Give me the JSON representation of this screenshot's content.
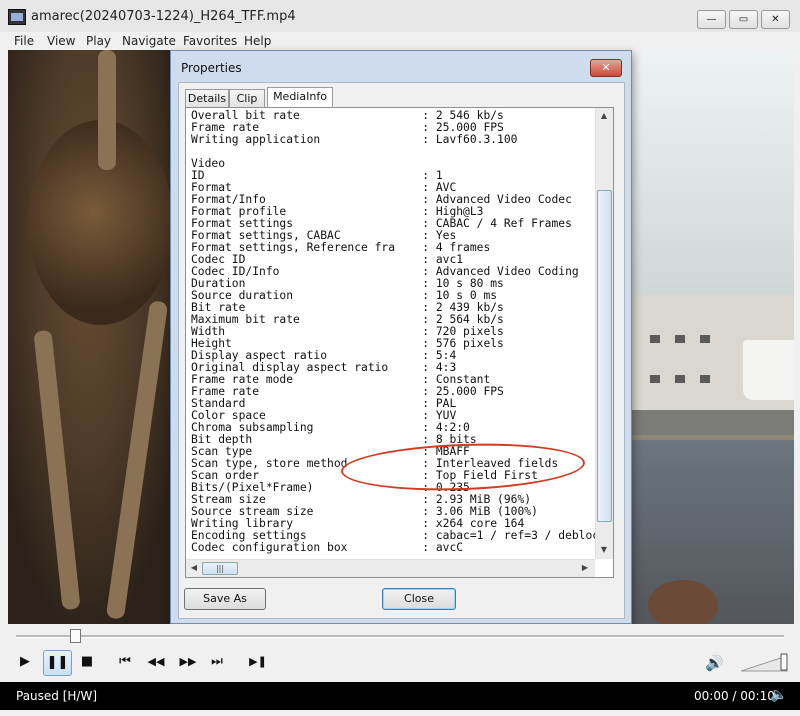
{
  "window": {
    "title": "amarec(20240703-1224)_H264_TFF.mp4",
    "minimize": "—",
    "maximize": "▭",
    "close": "✕"
  },
  "menu": [
    "File",
    "View",
    "Play",
    "Navigate",
    "Favorites",
    "Help"
  ],
  "dialog": {
    "title": "Properties",
    "close": "✕",
    "tabs": [
      "Details",
      "Clip",
      "MediaInfo"
    ],
    "active_tab": "MediaInfo",
    "info_lines": [
      "Overall bit rate                  : 2 546 kb/s",
      "Frame rate                        : 25.000 FPS",
      "Writing application               : Lavf60.3.100",
      "",
      "Video",
      "ID                                : 1",
      "Format                            : AVC",
      "Format/Info                       : Advanced Video Codec",
      "Format profile                    : High@L3",
      "Format settings                   : CABAC / 4 Ref Frames",
      "Format settings, CABAC            : Yes",
      "Format settings, Reference fra    : 4 frames",
      "Codec ID                          : avc1",
      "Codec ID/Info                     : Advanced Video Coding",
      "Duration                          : 10 s 80 ms",
      "Source duration                   : 10 s 0 ms",
      "Bit rate                          : 2 439 kb/s",
      "Maximum bit rate                  : 2 564 kb/s",
      "Width                             : 720 pixels",
      "Height                            : 576 pixels",
      "Display aspect ratio              : 5:4",
      "Original display aspect ratio     : 4:3",
      "Frame rate mode                   : Constant",
      "Frame rate                        : 25.000 FPS",
      "Standard                          : PAL",
      "Color space                       : YUV",
      "Chroma subsampling                : 4:2:0",
      "Bit depth                         : 8 bits",
      "Scan type                         : MBAFF",
      "Scan type, store method           : Interleaved fields",
      "Scan order                        : Top Field First",
      "Bits/(Pixel*Frame)                : 0.235",
      "Stream size                       : 2.93 MiB (96%)",
      "Source stream size                : 3.06 MiB (100%)",
      "Writing library                   : x264 core 164",
      "Encoding settings                 : cabac=1 / ref=3 / debloc",
      "Codec configuration box           : avcC"
    ],
    "save_as": "Save As",
    "close_button": "Close"
  },
  "controls": {
    "play": "▶",
    "pause": "❚❚",
    "stop": "■",
    "prev": "⏮",
    "rewind": "◀◀",
    "forward": "▶▶",
    "next": "⏭",
    "frame_step": "▶❚",
    "volume_icon": "speaker-icon"
  },
  "status": {
    "text": "Paused [H/W]",
    "time": "00:00 / 00:10"
  },
  "colors": {
    "dialog_frame": "#cfdced",
    "annotation": "#d23a22",
    "status_bar": "#000000"
  }
}
